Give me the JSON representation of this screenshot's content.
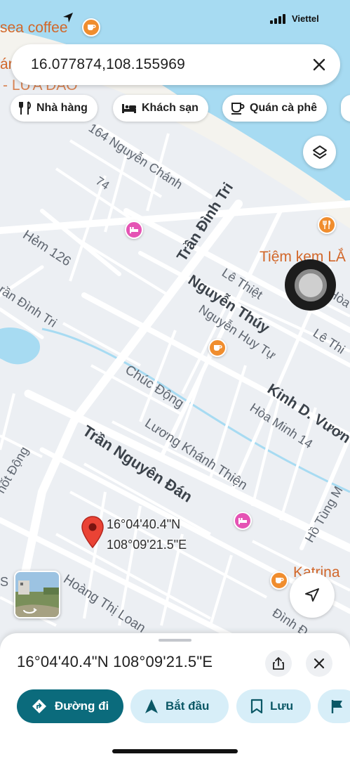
{
  "status_bar": {
    "carrier": "Viettel",
    "location_arrow_icon": "location-arrow-icon"
  },
  "search": {
    "value": "16.077874,108.155969",
    "clear_icon": "close-icon"
  },
  "chips": [
    {
      "label": "Nhà hàng",
      "icon": "restaurant-icon"
    },
    {
      "label": "Khách sạn",
      "icon": "hotel-icon"
    },
    {
      "label": "Quán cà phê",
      "icon": "coffee-icon"
    }
  ],
  "map": {
    "water_color": "#a7dbf2",
    "land_color": "#eceff3",
    "road_color": "#ffffff",
    "labels": {
      "sea_coffee": "sea coffee",
      "top_left_fragment": "ár",
      "lua_dao": "- LỪA ĐẢO",
      "nguyen_chanh": "164 Nguyễn Chánh",
      "num_74": "74",
      "hem_126": "Hẻm 126",
      "tran_dinh_tri_main": "Trần Đình Tri",
      "tran_dinh_tri_left": "rần Đình Tri",
      "tiem_kem": "Tiệm kem LẮ",
      "le_thiet": "Lê Thiệt",
      "hoa_fragment": "Hòa",
      "nguyen_thuy": "Nguyễn Thúy",
      "le_thi": "Lê Thi",
      "nguyen_huy_tu": "Nguyễn Huy Tự",
      "chuc_dong": "Chúc Động",
      "kinh_d_vuong": "Kinh D. Vươn",
      "hoa_minh_14": "Hòa Minh 14",
      "luong_khanh_thien": "Lương Khánh Thiện",
      "tran_nguyen_dan": "Trần Nguyên Đán",
      "ho_tung_m": "Hồ Tùng M",
      "hot_dong": "hốt Động",
      "hoang_thi_loan": "Hoàng Thị Loan",
      "katrina": "Katrina",
      "dinh_d": "Đình Đ",
      "s_fragment": "S"
    }
  },
  "pin": {
    "lat": "16°04'40.4\"N",
    "lng": "108°09'21.5\"E",
    "icon": "red-pin-icon"
  },
  "layers_icon": "layers-icon",
  "navigate_icon": "navigation-arrow-icon",
  "sheet": {
    "title": "16°04'40.4\"N 108°09'21.5\"E",
    "share_icon": "share-icon",
    "close_icon": "close-icon",
    "actions": [
      {
        "label": "Đường đi",
        "icon": "directions-icon"
      },
      {
        "label": "Bắt đầu",
        "icon": "navigation-icon"
      },
      {
        "label": "Lưu",
        "icon": "bookmark-icon"
      },
      {
        "label": "",
        "icon": "flag-icon"
      }
    ]
  }
}
